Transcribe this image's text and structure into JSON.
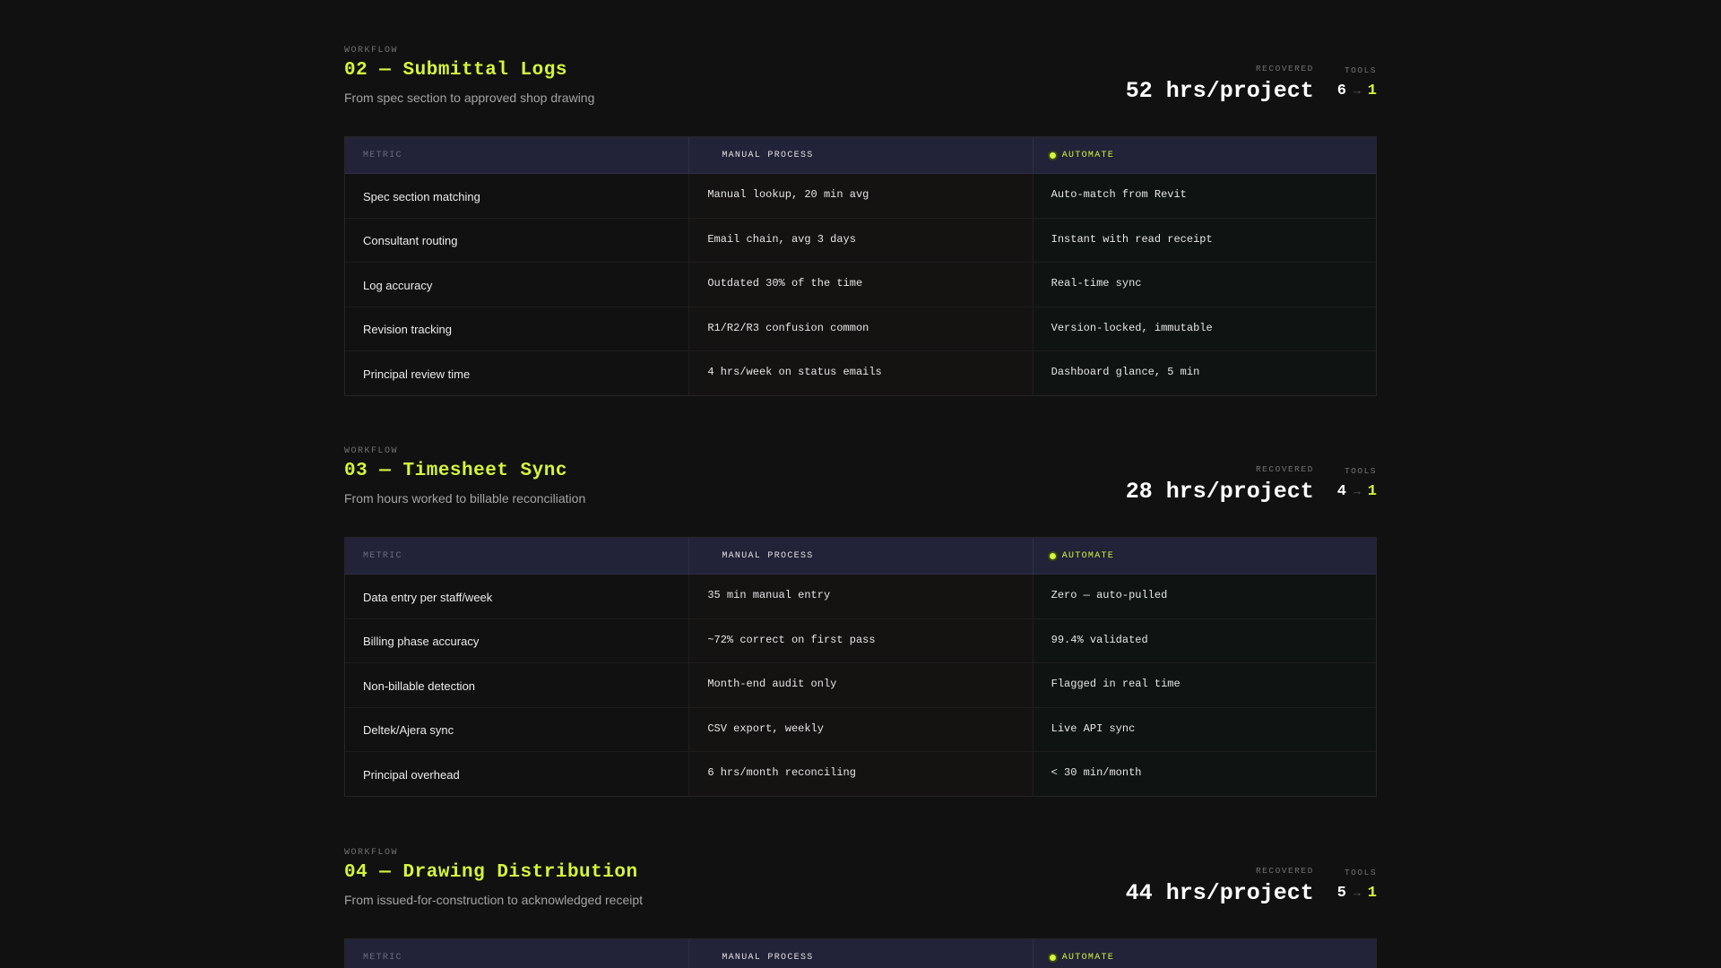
{
  "workflows": [
    {
      "kicker": "WORKFLOW",
      "title": "02 — Submittal Logs",
      "subtitle": "From spec section to approved shop drawing",
      "recovered_label": "RECOVERED",
      "recovered_value": "52 hrs/project",
      "tools_label": "TOOLS",
      "tools_before": "6",
      "tools_arrow": "→",
      "tools_after": "1",
      "table": {
        "headers": {
          "metric": "METRIC",
          "manual": "MANUAL PROCESS",
          "auto": "AUTOMATE"
        },
        "rows": [
          {
            "metric": "Spec section matching",
            "manual": "Manual lookup, 20 min avg",
            "auto": "Auto-match from Revit"
          },
          {
            "metric": "Consultant routing",
            "manual": "Email chain, avg 3 days",
            "auto": "Instant with read receipt"
          },
          {
            "metric": "Log accuracy",
            "manual": "Outdated 30% of the time",
            "auto": "Real-time sync"
          },
          {
            "metric": "Revision tracking",
            "manual": "R1/R2/R3 confusion common",
            "auto": "Version-locked, immutable"
          },
          {
            "metric": "Principal review time",
            "manual": "4 hrs/week on status emails",
            "auto": "Dashboard glance, 5 min"
          }
        ]
      }
    },
    {
      "kicker": "WORKFLOW",
      "title": "03 — Timesheet Sync",
      "subtitle": "From hours worked to billable reconciliation",
      "recovered_label": "RECOVERED",
      "recovered_value": "28 hrs/project",
      "tools_label": "TOOLS",
      "tools_before": "4",
      "tools_arrow": "→",
      "tools_after": "1",
      "table": {
        "headers": {
          "metric": "METRIC",
          "manual": "MANUAL PROCESS",
          "auto": "AUTOMATE"
        },
        "rows": [
          {
            "metric": "Data entry per staff/week",
            "manual": "35 min manual entry",
            "auto": "Zero — auto-pulled"
          },
          {
            "metric": "Billing phase accuracy",
            "manual": "~72% correct on first pass",
            "auto": "99.4% validated"
          },
          {
            "metric": "Non-billable detection",
            "manual": "Month-end audit only",
            "auto": "Flagged in real time"
          },
          {
            "metric": "Deltek/Ajera sync",
            "manual": "CSV export, weekly",
            "auto": "Live API sync"
          },
          {
            "metric": "Principal overhead",
            "manual": "6 hrs/month reconciling",
            "auto": "< 30 min/month"
          }
        ]
      }
    },
    {
      "kicker": "WORKFLOW",
      "title": "04 — Drawing Distribution",
      "subtitle": "From issued-for-construction to acknowledged receipt",
      "recovered_label": "RECOVERED",
      "recovered_value": "44 hrs/project",
      "tools_label": "TOOLS",
      "tools_before": "5",
      "tools_arrow": "→",
      "tools_after": "1",
      "table": {
        "headers": {
          "metric": "METRIC",
          "manual": "MANUAL PROCESS",
          "auto": "AUTOMATE"
        },
        "rows": []
      }
    }
  ],
  "colors": {
    "background": "#111111",
    "accent": "#d4f53c",
    "header_bg": "#222238",
    "manual_bg": "#151212",
    "auto_bg": "#0f1412"
  }
}
